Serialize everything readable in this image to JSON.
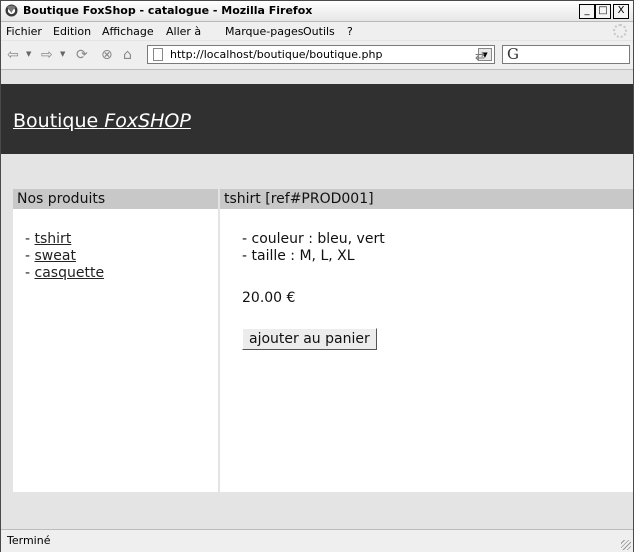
{
  "window": {
    "title": "Boutique FoxShop - catalogue - Mozilla Firefox",
    "minimize": "_",
    "maximize": "□",
    "close": "X"
  },
  "menubar": {
    "items": [
      "Fichier",
      "Edition",
      "Affichage",
      "Aller à",
      "Marque-pages",
      "Outils",
      "?"
    ]
  },
  "toolbar": {
    "url": "http://localhost/boutique/boutique.php",
    "search_glyph": "G"
  },
  "page": {
    "site_title_prefix": "Boutique",
    "site_title_brand": "FoxSHOP",
    "sidebar": {
      "heading": "Nos produits",
      "products": [
        "tshirt",
        "sweat",
        "casquette"
      ]
    },
    "product": {
      "heading": "tshirt [ref#PROD001]",
      "details": [
        "- couleur : bleu, vert",
        "- taille : M, L, XL"
      ],
      "price": "20.00 €",
      "add_button": "ajouter au panier"
    }
  },
  "statusbar": {
    "text": "Terminé"
  }
}
